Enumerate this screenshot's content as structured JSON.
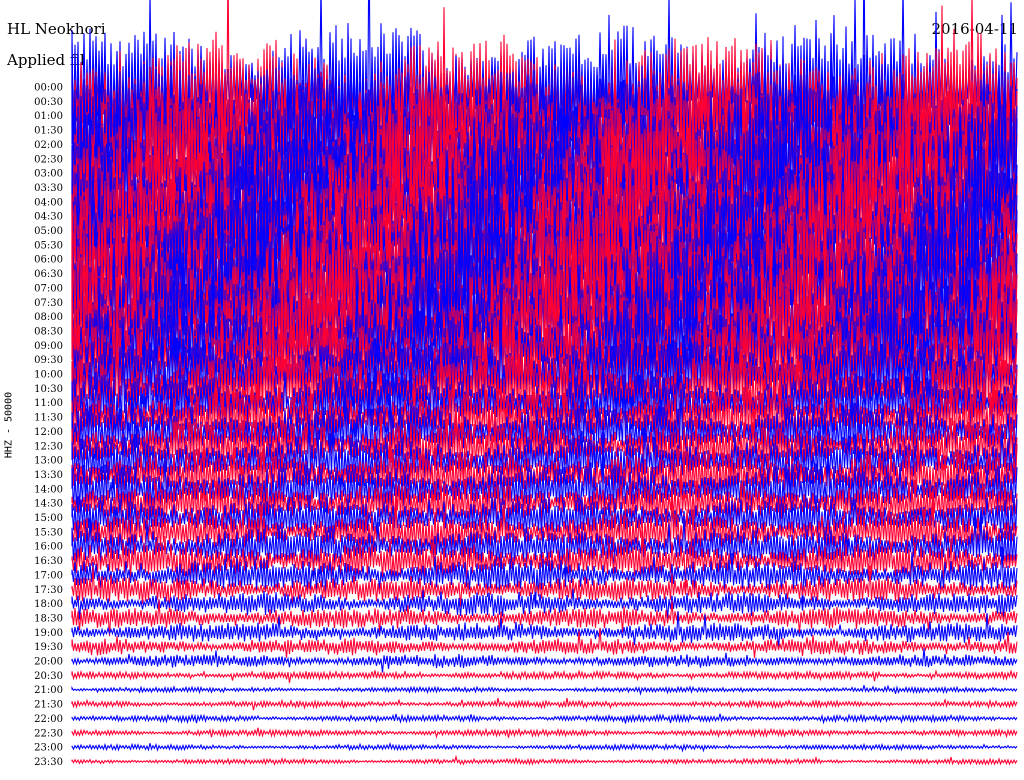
{
  "header": {
    "station": "HL Neokhori",
    "filter_text": "Applied fil",
    "date_text": "2016-04-11"
  },
  "chart_data": {
    "type": "line",
    "title": "HL Neokhori",
    "ylabel": "HHZ - 50000",
    "grid": false,
    "series_colors": [
      "#0000ff",
      "#ff0033"
    ],
    "x": {
      "label": "",
      "range_minutes": [
        0,
        30
      ]
    },
    "rows": [
      {
        "time": "00:00",
        "color": "#0000ff",
        "amplitude": 1.0
      },
      {
        "time": "00:30",
        "color": "#ff0033",
        "amplitude": 1.0
      },
      {
        "time": "01:00",
        "color": "#0000ff",
        "amplitude": 1.0
      },
      {
        "time": "01:30",
        "color": "#ff0033",
        "amplitude": 1.0
      },
      {
        "time": "02:00",
        "color": "#0000ff",
        "amplitude": 1.0
      },
      {
        "time": "02:30",
        "color": "#ff0033",
        "amplitude": 1.0
      },
      {
        "time": "03:00",
        "color": "#0000ff",
        "amplitude": 1.0
      },
      {
        "time": "03:30",
        "color": "#ff0033",
        "amplitude": 1.0
      },
      {
        "time": "04:00",
        "color": "#0000ff",
        "amplitude": 1.0
      },
      {
        "time": "04:30",
        "color": "#ff0033",
        "amplitude": 1.0
      },
      {
        "time": "05:00",
        "color": "#0000ff",
        "amplitude": 1.0
      },
      {
        "time": "05:30",
        "color": "#ff0033",
        "amplitude": 1.0
      },
      {
        "time": "06:00",
        "color": "#0000ff",
        "amplitude": 1.0
      },
      {
        "time": "06:30",
        "color": "#ff0033",
        "amplitude": 1.0
      },
      {
        "time": "07:00",
        "color": "#0000ff",
        "amplitude": 1.0
      },
      {
        "time": "07:30",
        "color": "#ff0033",
        "amplitude": 0.95
      },
      {
        "time": "08:00",
        "color": "#0000ff",
        "amplitude": 0.9
      },
      {
        "time": "08:30",
        "color": "#ff0033",
        "amplitude": 0.85
      },
      {
        "time": "09:00",
        "color": "#0000ff",
        "amplitude": 0.8
      },
      {
        "time": "09:30",
        "color": "#ff0033",
        "amplitude": 0.75
      },
      {
        "time": "10:00",
        "color": "#0000ff",
        "amplitude": 0.65
      },
      {
        "time": "10:30",
        "color": "#ff0033",
        "amplitude": 0.55
      },
      {
        "time": "11:00",
        "color": "#0000ff",
        "amplitude": 0.5
      },
      {
        "time": "11:30",
        "color": "#ff0033",
        "amplitude": 0.45
      },
      {
        "time": "12:00",
        "color": "#0000ff",
        "amplitude": 0.45
      },
      {
        "time": "12:30",
        "color": "#ff0033",
        "amplitude": 0.42
      },
      {
        "time": "13:00",
        "color": "#0000ff",
        "amplitude": 0.4
      },
      {
        "time": "13:30",
        "color": "#ff0033",
        "amplitude": 0.4
      },
      {
        "time": "14:00",
        "color": "#0000ff",
        "amplitude": 0.38
      },
      {
        "time": "14:30",
        "color": "#ff0033",
        "amplitude": 0.35
      },
      {
        "time": "15:00",
        "color": "#0000ff",
        "amplitude": 0.33
      },
      {
        "time": "15:30",
        "color": "#ff0033",
        "amplitude": 0.32
      },
      {
        "time": "16:00",
        "color": "#0000ff",
        "amplitude": 0.3
      },
      {
        "time": "16:30",
        "color": "#ff0033",
        "amplitude": 0.28
      },
      {
        "time": "17:00",
        "color": "#0000ff",
        "amplitude": 0.25
      },
      {
        "time": "17:30",
        "color": "#ff0033",
        "amplitude": 0.2
      },
      {
        "time": "18:00",
        "color": "#0000ff",
        "amplitude": 0.18
      },
      {
        "time": "18:30",
        "color": "#ff0033",
        "amplitude": 0.16
      },
      {
        "time": "19:00",
        "color": "#0000ff",
        "amplitude": 0.15
      },
      {
        "time": "19:30",
        "color": "#ff0033",
        "amplitude": 0.13
      },
      {
        "time": "20:00",
        "color": "#0000ff",
        "amplitude": 0.1
      },
      {
        "time": "20:30",
        "color": "#ff0033",
        "amplitude": 0.06
      },
      {
        "time": "21:00",
        "color": "#0000ff",
        "amplitude": 0.04
      },
      {
        "time": "21:30",
        "color": "#ff0033",
        "amplitude": 0.05
      },
      {
        "time": "22:00",
        "color": "#0000ff",
        "amplitude": 0.05
      },
      {
        "time": "22:30",
        "color": "#ff0033",
        "amplitude": 0.05
      },
      {
        "time": "23:00",
        "color": "#0000ff",
        "amplitude": 0.04
      },
      {
        "time": "23:30",
        "color": "#ff0033",
        "amplitude": 0.04
      }
    ]
  }
}
